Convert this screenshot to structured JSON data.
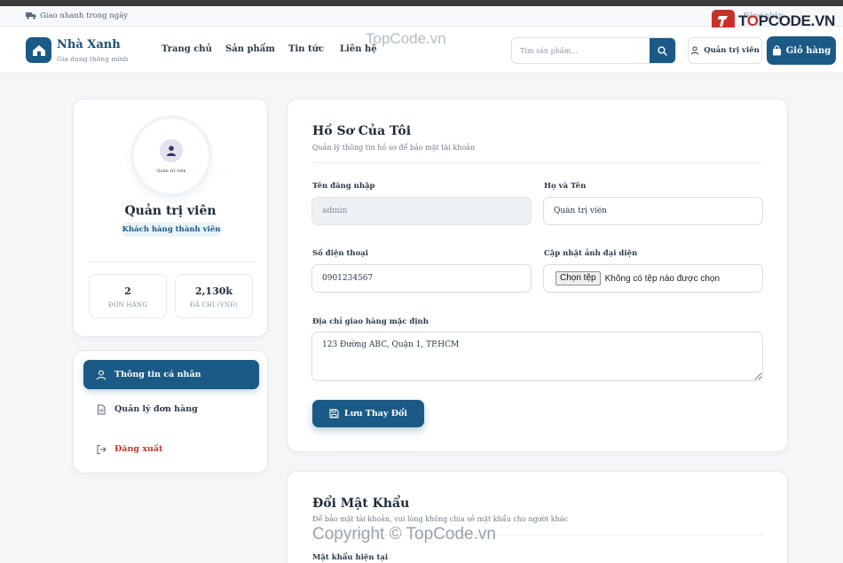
{
  "infobar": {
    "shipping_text": "Giao nhanh trong ngày",
    "login_text": "Đăng nhập"
  },
  "watermark_logo": {
    "brand": "TOPCODE.VN"
  },
  "header": {
    "brand_name": "Nhà Xanh",
    "brand_tagline": "Gia dụng thông minh",
    "nav": [
      "Trang chủ",
      "Sản phẩm",
      "Tin tức",
      "Liên hệ"
    ],
    "search_placeholder": "Tìm sản phẩm...",
    "account_label": "Quản trị viên",
    "cart_label": "Giỏ hàng"
  },
  "watermarks": {
    "top": "TopCode.vn",
    "bottom": "Copyright © TopCode.vn"
  },
  "profile": {
    "avatar_caption": "Quản trị viên",
    "name": "Quản trị viên",
    "badge": "Khách hàng thành viên",
    "stats": [
      {
        "value": "2",
        "label": "ĐƠN HÀNG"
      },
      {
        "value": "2,130k",
        "label": "ĐÃ CHI (VNĐ)"
      }
    ]
  },
  "menu": {
    "items": [
      {
        "label": "Thông tin cá nhân",
        "icon": "user-icon",
        "active": true
      },
      {
        "label": "Quản lý đơn hàng",
        "icon": "document-icon",
        "active": false
      },
      {
        "label": "Đăng xuất",
        "icon": "logout-icon",
        "active": false
      }
    ]
  },
  "profile_form": {
    "title": "Hồ Sơ Của Tôi",
    "subtitle": "Quản lý thông tin hồ sơ để bảo mật tài khoản",
    "username_label": "Tên đăng nhập",
    "username_value": "admin",
    "fullname_label": "Họ và Tên",
    "fullname_value": "Quản trị viên",
    "phone_label": "Số điện thoại",
    "phone_value": "0901234567",
    "avatar_label": "Cập nhật ảnh đại diện",
    "file_button": "Chọn tệp",
    "file_status": "Không có tệp nào được chọn",
    "address_label": "Địa chỉ giao hàng mặc định",
    "address_value": "123 Đường ABC, Quận 1, TP.HCM",
    "save_label": "Lưu Thay Đổi"
  },
  "password_form": {
    "title": "Đổi Mật Khẩu",
    "subtitle": "Để bảo mật tài khoản, vui lòng không chia sẻ mật khẩu cho người khác",
    "current_label": "Mật khẩu hiện tại"
  },
  "colors": {
    "primary": "#1b5a86",
    "danger": "#c0392b",
    "background": "#f4f6f8"
  }
}
